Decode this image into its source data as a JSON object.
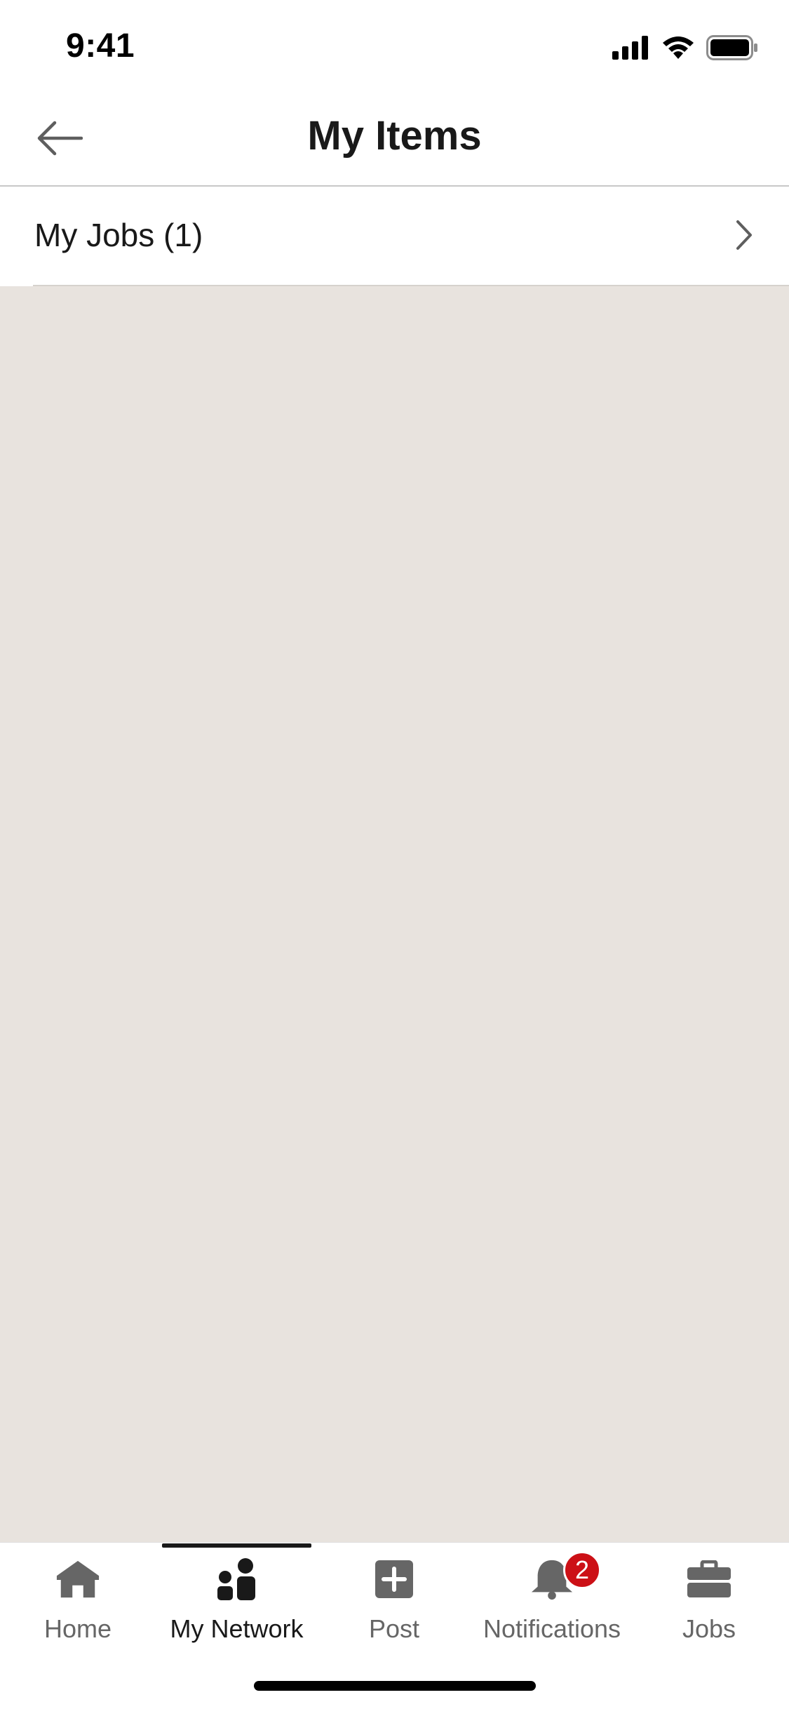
{
  "status_bar": {
    "time": "9:41"
  },
  "header": {
    "title": "My Items",
    "back_icon": "arrow-left-icon"
  },
  "list": {
    "items": [
      {
        "label": "My Jobs (1)",
        "icon": "chevron-right-icon"
      }
    ]
  },
  "tab_bar": {
    "active": "My Network",
    "tabs": [
      {
        "label": "Home",
        "icon": "home-icon"
      },
      {
        "label": "My Network",
        "icon": "network-icon"
      },
      {
        "label": "Post",
        "icon": "plus-square-icon"
      },
      {
        "label": "Notifications",
        "icon": "bell-icon",
        "badge": "2"
      },
      {
        "label": "Jobs",
        "icon": "briefcase-icon"
      }
    ]
  },
  "colors": {
    "background": "#e8e3de",
    "surface": "#ffffff",
    "text": "#191919",
    "muted": "#666666",
    "badge": "#cc1016"
  }
}
